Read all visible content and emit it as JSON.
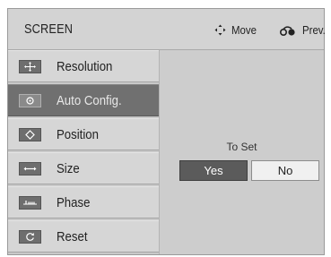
{
  "header": {
    "title": "SCREEN",
    "move_label": "Move",
    "prev_label": "Prev."
  },
  "menu": {
    "items": [
      {
        "label": "Resolution",
        "icon": "move-arrows-icon",
        "selected": false
      },
      {
        "label": "Auto Config.",
        "icon": "auto-config-icon",
        "selected": true
      },
      {
        "label": "Position",
        "icon": "position-icon",
        "selected": false
      },
      {
        "label": "Size",
        "icon": "size-icon",
        "selected": false
      },
      {
        "label": "Phase",
        "icon": "phase-icon",
        "selected": false
      },
      {
        "label": "Reset",
        "icon": "reset-icon",
        "selected": false
      }
    ]
  },
  "panel": {
    "prompt": "To Set",
    "yes_label": "Yes",
    "no_label": "No"
  },
  "colors": {
    "background": "#c9c9c9",
    "selected_item": "#707070",
    "yes_button": "#5b5b5b",
    "no_button": "#f0f0f0"
  }
}
